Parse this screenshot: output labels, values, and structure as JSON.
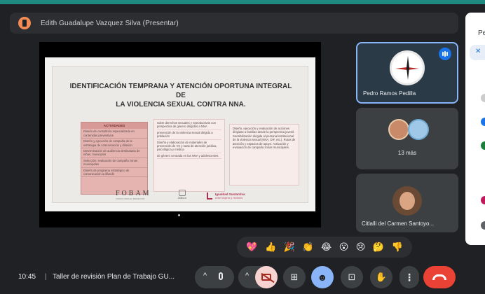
{
  "presenter": {
    "label": "Edith Guadalupe Vazquez Silva (Presentar)"
  },
  "side_panel": {
    "title": "Pe",
    "chip_icon": "mic-off-icon"
  },
  "slide": {
    "title_line1": "IDENTIFICACIÓN TEMPRANA Y ATENCIÓN OPORTUNA INTEGRAL DE",
    "title_line2": "LA VIOLENCIA SEXUAL CONTRA NNA.",
    "activities_header": "ACTIVIDADES",
    "activities": [
      "Diseño de consultoría especializada en contenidos preventivos",
      "Diseño y ejecución de campaña de la estrategia de comunicación y difusión",
      "Determinación de audiencia destinataria de niñas, municipios",
      "Selección, evaluación de campaña zonas municipales",
      "Diseño de programa estratégico de comunicación a difundir"
    ],
    "middle_column": [
      "sobre derechos sexuales y reproductivos con perspectiva de género dirigidos a NNA",
      "prevención de la violencia sexual dirigido a población",
      "Diseño y elaboración de materiales de prevención de VS y rutas de atención jurídica, psicológica y médica",
      "de género centrada en las NNA y adolescentes"
    ],
    "right_column": "Diseño, ejecución y evaluación de acciones dirigidas a familias desde la perspectiva juvenil. Sensibilización dirigida al personal institucional de la violencia sexual (NNA, DIF, etc.). Rutas de atención y espacios de apoyo. Activación y evaluación de campaña zonas municipales.",
    "logo_fobam": "FOBAM",
    "logo_fobam_sub": "FONDO PARA EL BIENESTAR",
    "logo_jalisco": "Jalisco",
    "logo_igualdad": "Igualdad Sustantiva",
    "logo_igualdad_sub": "entre Mujeres y Hombres"
  },
  "participants": [
    {
      "name": "Pedro Ramos Pedilla",
      "avatar": "compass-avatar",
      "speaking": true
    },
    {
      "count_label": "13 más"
    },
    {
      "name": "Citlalli del Carmen Santoyo..."
    }
  ],
  "reactions": [
    "💖",
    "👍",
    "🎉",
    "👏",
    "😂",
    "😮",
    "😢",
    "🤔",
    "👎"
  ],
  "meeting": {
    "time": "10:45",
    "separator": "|",
    "title": "Taller de revisión Plan de Trabajo GU..."
  },
  "controls": {
    "more_label": "⋮",
    "chevron": "^",
    "captions": "⊞",
    "hand": "✋",
    "present": "⊡"
  },
  "colors": {
    "background": "#202124",
    "accent": "#1f8a80",
    "active_tile_border": "#8ab4f8",
    "end_call": "#ea4335",
    "slide_pink": "#e6b4b0"
  }
}
